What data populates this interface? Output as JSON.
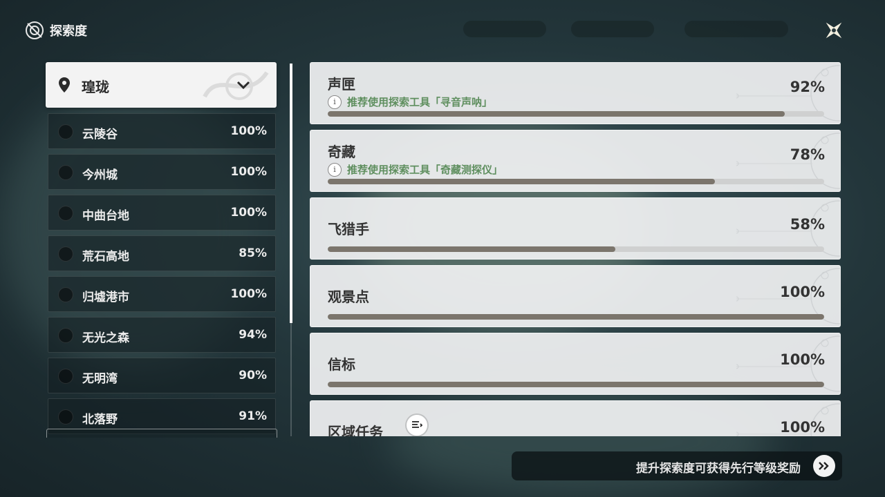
{
  "header": {
    "title": "探索度",
    "title_icon": "compass-exploration-icon",
    "close_icon": "close-star-icon"
  },
  "region_selector": {
    "name": "瑝珑",
    "pin_icon": "location-pin-icon",
    "chevron_icon": "chevron-down-icon"
  },
  "subregions": [
    {
      "name": "云陵谷",
      "percent": "100%"
    },
    {
      "name": "今州城",
      "percent": "100%"
    },
    {
      "name": "中曲台地",
      "percent": "100%"
    },
    {
      "name": "荒石高地",
      "percent": "85%"
    },
    {
      "name": "归墟港市",
      "percent": "100%"
    },
    {
      "name": "无光之森",
      "percent": "94%"
    },
    {
      "name": "无明湾",
      "percent": "90%"
    },
    {
      "name": "北落野",
      "percent": "91%"
    }
  ],
  "categories": [
    {
      "name": "声匣",
      "percent": "92%",
      "progress": 0.92,
      "hint": "推荐使用探索工具「寻音声呐」"
    },
    {
      "name": "奇藏",
      "percent": "78%",
      "progress": 0.78,
      "hint": "推荐使用探索工具「奇藏测探仪」"
    },
    {
      "name": "飞猎手",
      "percent": "58%",
      "progress": 0.58,
      "hint": ""
    },
    {
      "name": "观景点",
      "percent": "100%",
      "progress": 1.0,
      "hint": ""
    },
    {
      "name": "信标",
      "percent": "100%",
      "progress": 1.0,
      "hint": ""
    },
    {
      "name": "区域任务",
      "percent": "100%",
      "progress": 1.0,
      "hint": ""
    }
  ],
  "footer": {
    "text": "提升探索度可获得先行等级奖励",
    "button_icon": "double-chevron-right-icon"
  },
  "colors": {
    "progress_fill": "#7b756c",
    "hint_text": "#5f8f5f",
    "card_bg": "#f0f1f2"
  }
}
